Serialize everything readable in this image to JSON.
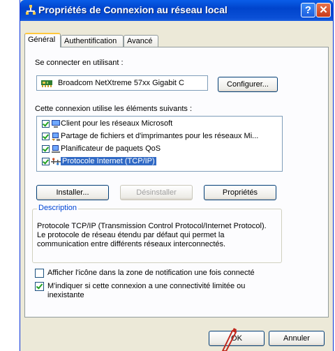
{
  "window": {
    "title": "Propriétés de Connexion au réseau local",
    "help_label": "?",
    "close_label": "✕"
  },
  "tabs": [
    {
      "label": "Général",
      "active": true
    },
    {
      "label": "Authentification",
      "active": false
    },
    {
      "label": "Avancé",
      "active": false
    }
  ],
  "general": {
    "connect_using_label": "Se connecter en utilisant :",
    "adapter_name": "Broadcom NetXtreme 57xx Gigabit C",
    "configure_button": "Configurer...",
    "components_label": "Cette connexion utilise les éléments suivants :",
    "components": [
      {
        "label": "Client pour les réseaux Microsoft",
        "checked": true,
        "icon": "network-client-icon"
      },
      {
        "label": "Partage de fichiers et d'imprimantes pour les réseaux Mi...",
        "checked": true,
        "icon": "file-printer-sharing-icon"
      },
      {
        "label": "Planificateur de paquets QoS",
        "checked": true,
        "icon": "qos-scheduler-icon"
      },
      {
        "label": "Protocole Internet (TCP/IP)",
        "checked": true,
        "icon": "network-protocol-icon",
        "selected": true
      }
    ],
    "install_button": "Installer...",
    "uninstall_button": "Désinstaller",
    "properties_button": "Propriétés",
    "description_title": "Description",
    "description_text": "Protocole TCP/IP (Transmission Control Protocol/Internet Protocol). Le protocole de réseau étendu par défaut qui permet la communication entre différents réseaux interconnectés.",
    "show_icon_label": "Afficher l'icône dans la zone de notification une fois connecté",
    "show_icon_checked": false,
    "notify_limited_label": "M'indiquer si cette connexion a une connectivité limitée ou inexistante",
    "notify_limited_checked": true
  },
  "footer": {
    "ok_button": "OK",
    "cancel_button": "Annuler"
  },
  "colors": {
    "titlebar": "#0a4fd6",
    "selection": "#316ac5",
    "group_title": "#0046d5",
    "close_button": "#c9391a"
  }
}
